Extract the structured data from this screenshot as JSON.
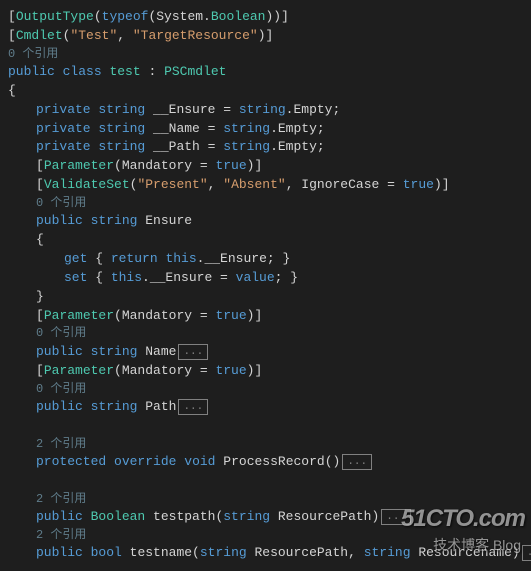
{
  "l1": {
    "a": "[",
    "b": "OutputType",
    "c": "(",
    "d": "typeof",
    "e": "(System.",
    "f": "Boolean",
    "g": "))]"
  },
  "l2": {
    "a": "[",
    "b": "Cmdlet",
    "c": "(",
    "d": "\"Test\"",
    "e": ", ",
    "f": "\"TargetResource\"",
    "g": ")]"
  },
  "ref0": "0 个引用",
  "l3": {
    "a": "public",
    "b": " ",
    "c": "class",
    "d": " ",
    "e": "test",
    "f": " : ",
    "g": "PSCmdlet"
  },
  "l4": "{",
  "l5": {
    "a": "private",
    "b": " ",
    "c": "string",
    "d": " __Ensure = ",
    "e": "string",
    "f": ".Empty;"
  },
  "l6": {
    "a": "private",
    "b": " ",
    "c": "string",
    "d": " __Name = ",
    "e": "string",
    "f": ".Empty;"
  },
  "l7": {
    "a": "private",
    "b": " ",
    "c": "string",
    "d": " __Path = ",
    "e": "string",
    "f": ".Empty;"
  },
  "l8": {
    "a": "[",
    "b": "Parameter",
    "c": "(Mandatory = ",
    "d": "true",
    "e": ")]"
  },
  "l9": {
    "a": "[",
    "b": "ValidateSet",
    "c": "(",
    "d": "\"Present\"",
    "e": ", ",
    "f": "\"Absent\"",
    "g": ", IgnoreCase = ",
    "h": "true",
    "i": ")]"
  },
  "l10": {
    "a": "public",
    "b": " ",
    "c": "string",
    "d": " Ensure"
  },
  "l11": "{",
  "l12": {
    "a": "get",
    "b": " { ",
    "c": "return",
    "d": " ",
    "e": "this",
    "f": ".__Ensure; }"
  },
  "l13": {
    "a": "set",
    "b": " { ",
    "c": "this",
    "d": ".__Ensure = ",
    "e": "value",
    "f": "; }"
  },
  "l14": "}",
  "l15": {
    "a": "[",
    "b": "Parameter",
    "c": "(Mandatory = ",
    "d": "true",
    "e": ")]"
  },
  "l16": {
    "a": "public",
    "b": " ",
    "c": "string",
    "d": " Name"
  },
  "l17": {
    "a": "[",
    "b": "Parameter",
    "c": "(Mandatory = ",
    "d": "true",
    "e": ")]"
  },
  "l18": {
    "a": "public",
    "b": " ",
    "c": "string",
    "d": " Path"
  },
  "ref2": "2 个引用",
  "l19": {
    "a": "protected",
    "b": " ",
    "c": "override",
    "d": " ",
    "e": "void",
    "f": " ProcessRecord()"
  },
  "l20": {
    "a": "public",
    "b": " ",
    "c": "Boolean",
    "d": " testpath(",
    "e": "string",
    "f": " ResourcePath)"
  },
  "l21": {
    "a": "public",
    "b": " ",
    "c": "bool",
    "d": " testname(",
    "e": "string",
    "f": " ResourcePath, ",
    "g": "string",
    "h": " Resourcename)"
  },
  "collapse": "...",
  "wm1": "51CTO.com",
  "wm2": "技术博客      Blog"
}
